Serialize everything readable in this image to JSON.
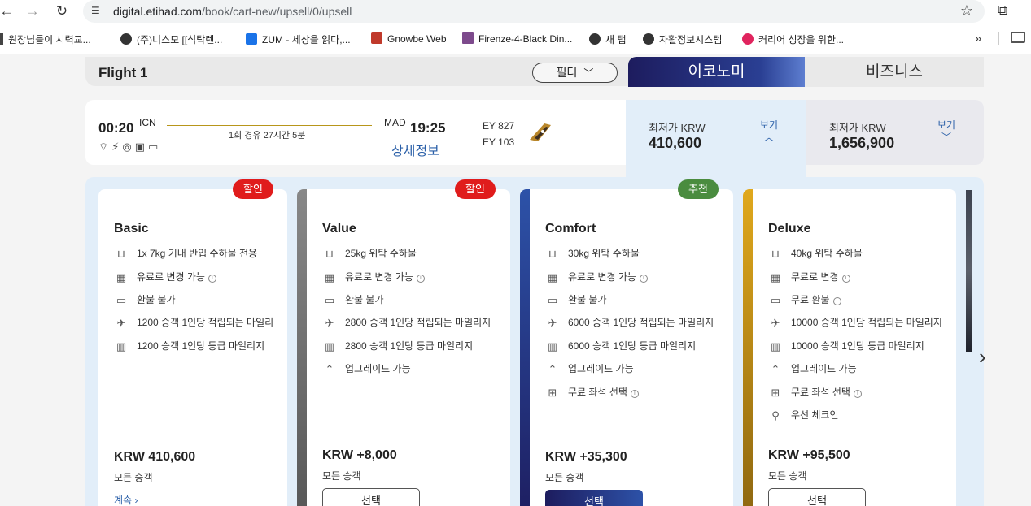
{
  "browser": {
    "url_host": "digital.etihad.com",
    "url_path": "/book/cart-new/upsell/0/upsell"
  },
  "bookmarks": [
    {
      "label": "원장님들이 시력교...",
      "color": "#444"
    },
    {
      "label": "(주)니스모 [[식탁렌...",
      "color": "#333"
    },
    {
      "label": "ZUM - 세상을 읽다,...",
      "color": "#1a73e8"
    },
    {
      "label": "Gnowbe Web",
      "color": "#c0392b"
    },
    {
      "label": "Firenze-4-Black Din...",
      "color": "#7d4a8c"
    },
    {
      "label": "새 탭",
      "color": "#333"
    },
    {
      "label": "자활정보시스템",
      "color": "#333"
    },
    {
      "label": "커리어 성장을 위한...",
      "color": "#e0245e"
    }
  ],
  "header": {
    "flight_title": "Flight 1",
    "filter_label": "필터",
    "tab_economy": "이코노미",
    "tab_business": "비즈니스"
  },
  "flight": {
    "dep_time": "00:20",
    "dep_code": "ICN",
    "stops": "1회 경유 27시간 5분",
    "arr_code": "MAD",
    "arr_time": "19:25",
    "details": "상세정보",
    "flight_no_1": "EY 827",
    "flight_no_2": "EY 103",
    "economy": {
      "label": "최저가 KRW",
      "price": "410,600",
      "view": "보기"
    },
    "business": {
      "label": "최저가 KRW",
      "price": "1,656,900",
      "view": "보기"
    }
  },
  "cards": [
    {
      "name": "Basic",
      "badge": "할인",
      "badge_color": "#e01c1c",
      "features": [
        {
          "icon": "baggage-icon",
          "text": "1x 7kg 기내 반입 수하물 전용",
          "info": false
        },
        {
          "icon": "calendar-icon",
          "text": "유료로 변경 가능",
          "info": true
        },
        {
          "icon": "refund-icon",
          "text": "환불 불가",
          "info": false
        },
        {
          "icon": "plane-miles-icon",
          "text": "1200 승객 1인당 적립되는 마일리",
          "info": false
        },
        {
          "icon": "tier-miles-icon",
          "text": "1200 승객 1인당 등급 마일리지",
          "info": false
        }
      ],
      "price": "KRW 410,600",
      "sub": "모든 승객",
      "more": "계속"
    },
    {
      "name": "Value",
      "badge": "할인",
      "badge_color": "#e01c1c",
      "features": [
        {
          "icon": "baggage-icon",
          "text": "25kg 위탁 수하물",
          "info": false
        },
        {
          "icon": "calendar-icon",
          "text": "유료로 변경 가능",
          "info": true
        },
        {
          "icon": "refund-icon",
          "text": "환불 불가",
          "info": false
        },
        {
          "icon": "plane-miles-icon",
          "text": "2800 승객 1인당 적립되는 마일리지",
          "info": false
        },
        {
          "icon": "tier-miles-icon",
          "text": "2800 승객 1인당 등급 마일리지",
          "info": false
        },
        {
          "icon": "upgrade-icon",
          "text": "업그레이드 가능",
          "info": false
        }
      ],
      "price": "KRW +8,000",
      "sub": "모든 승객",
      "button": "선택"
    },
    {
      "name": "Comfort",
      "badge": "추천",
      "badge_color": "#4a8c3f",
      "features": [
        {
          "icon": "baggage-icon",
          "text": "30kg 위탁 수하물",
          "info": false
        },
        {
          "icon": "calendar-icon",
          "text": "유료로 변경 가능",
          "info": true
        },
        {
          "icon": "refund-icon",
          "text": "환불 불가",
          "info": false
        },
        {
          "icon": "plane-miles-icon",
          "text": "6000 승객 1인당 적립되는 마일리지",
          "info": false
        },
        {
          "icon": "tier-miles-icon",
          "text": "6000 승객 1인당 등급 마일리지",
          "info": false
        },
        {
          "icon": "upgrade-icon",
          "text": "업그레이드 가능",
          "info": false
        },
        {
          "icon": "seat-icon",
          "text": "무료 좌석 선택",
          "info": true
        }
      ],
      "price": "KRW +35,300",
      "sub": "모든 승객",
      "button": "선택"
    },
    {
      "name": "Deluxe",
      "badge": "",
      "badge_color": "",
      "features": [
        {
          "icon": "baggage-icon",
          "text": "40kg 위탁 수하물",
          "info": false
        },
        {
          "icon": "calendar-icon",
          "text": "무료로 변경",
          "info": true
        },
        {
          "icon": "refund-icon",
          "text": "무료 환불",
          "info": true
        },
        {
          "icon": "plane-miles-icon",
          "text": "10000 승객 1인당 적립되는 마일리지",
          "info": false
        },
        {
          "icon": "tier-miles-icon",
          "text": "10000 승객 1인당 등급 마일리지",
          "info": false
        },
        {
          "icon": "upgrade-icon",
          "text": "업그레이드 가능",
          "info": false
        },
        {
          "icon": "seat-icon",
          "text": "무료 좌석 선택",
          "info": true
        },
        {
          "icon": "priority-checkin-icon",
          "text": "우선 체크인",
          "info": false
        }
      ],
      "price": "KRW +95,500",
      "sub": "모든 승객",
      "button": "선택"
    }
  ]
}
